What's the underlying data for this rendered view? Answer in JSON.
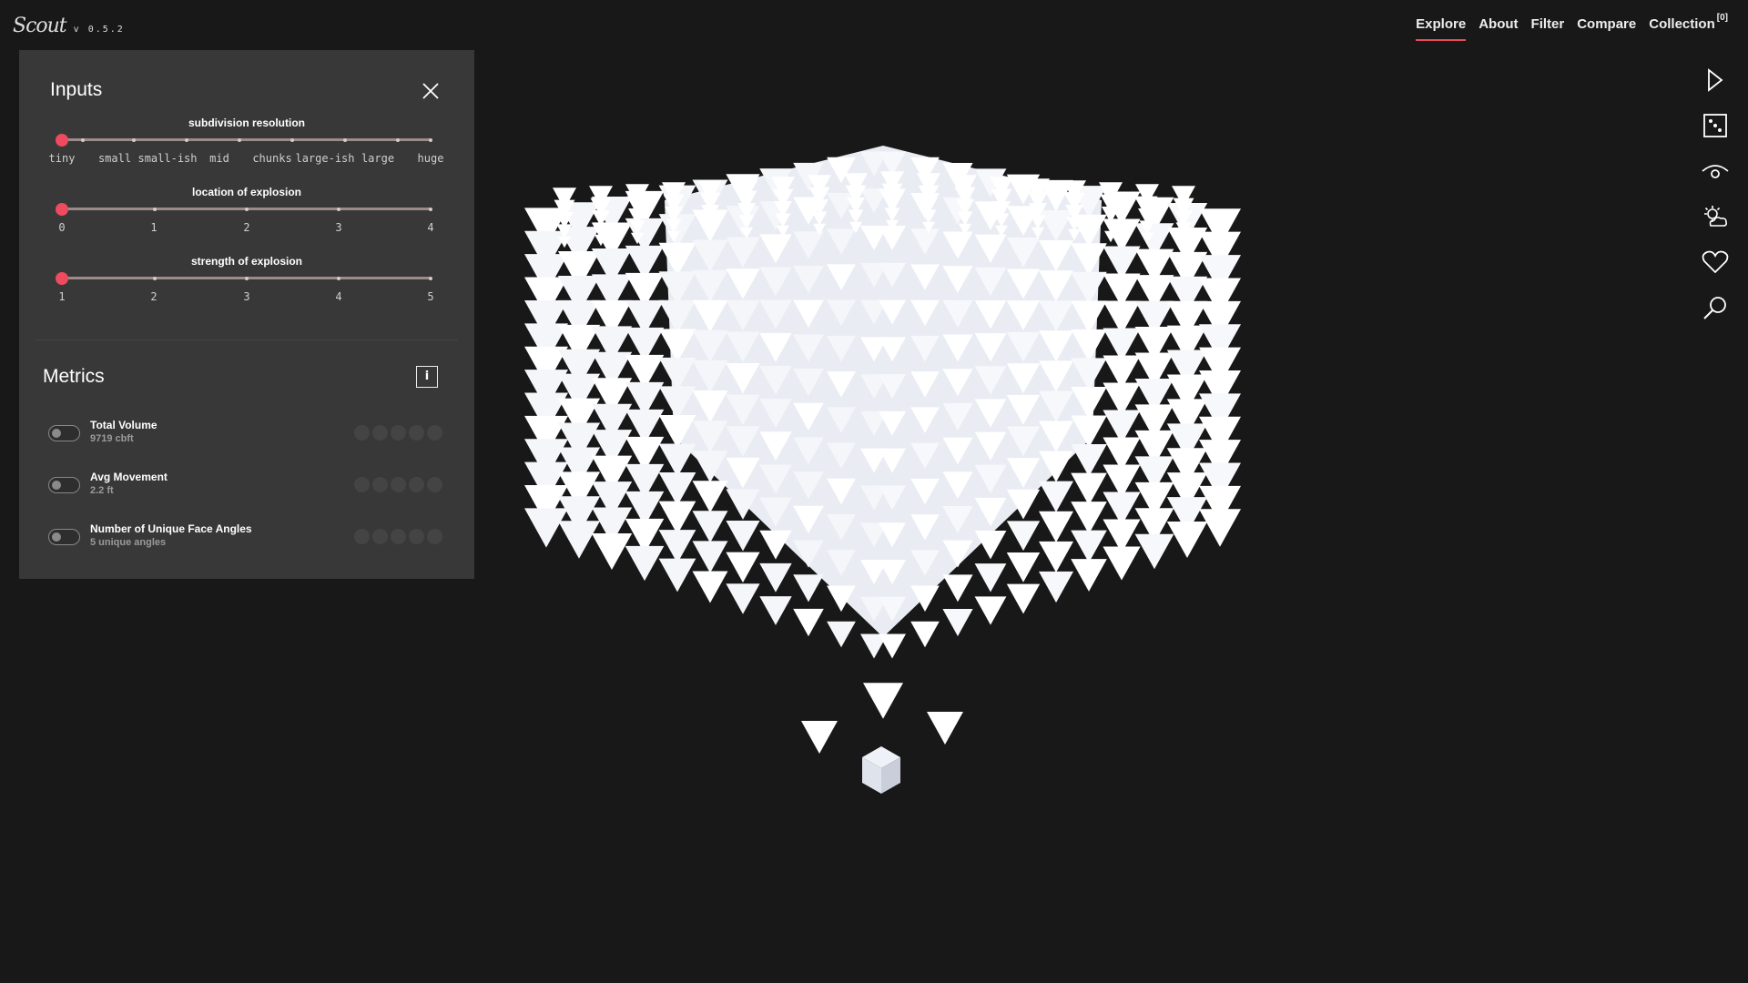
{
  "app": {
    "logo": "Scout",
    "version": "v 0.5.2"
  },
  "nav": [
    {
      "label": "Explore",
      "active": true
    },
    {
      "label": "About"
    },
    {
      "label": "Filter"
    },
    {
      "label": "Compare"
    },
    {
      "label": "Collection",
      "badge": "[0]"
    }
  ],
  "toolbar": [
    "play-icon",
    "dice-icon",
    "eye-icon",
    "weather-icon",
    "heart-icon",
    "search-icon"
  ],
  "inputs": {
    "title": "Inputs",
    "sliders": [
      {
        "title": "subdivision resolution",
        "ticks": [
          "tiny",
          "small",
          "small-ish",
          "mid",
          "chunks",
          "large-ish",
          "large",
          "huge"
        ],
        "value_index": 0
      },
      {
        "title": "location of explosion",
        "ticks": [
          "0",
          "1",
          "2",
          "3",
          "4"
        ],
        "value_index": 0
      },
      {
        "title": "strength of explosion",
        "ticks": [
          "1",
          "2",
          "3",
          "4",
          "5"
        ],
        "value_index": 0
      }
    ]
  },
  "metrics": {
    "title": "Metrics",
    "info_label": "i",
    "items": [
      {
        "name": "Total Volume",
        "value": "9719 cbft",
        "enabled": false,
        "rating": 0
      },
      {
        "name": "Avg Movement",
        "value": "2.2 ft",
        "enabled": false,
        "rating": 0
      },
      {
        "name": "Number of Unique Face Angles",
        "value": "5 unique angles",
        "enabled": false,
        "rating": 0
      }
    ]
  },
  "colors": {
    "accent": "#e84a5a",
    "background": "#181818",
    "panel": "#383838"
  }
}
